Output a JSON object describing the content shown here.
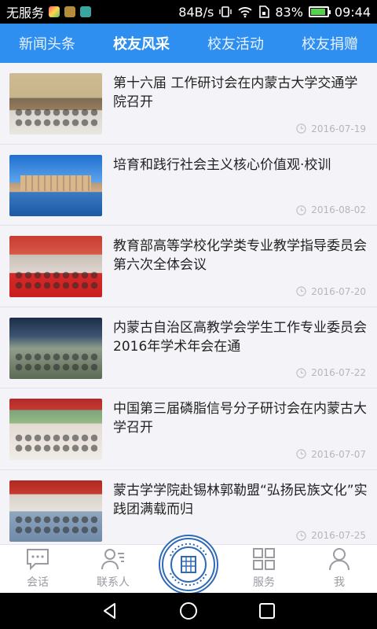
{
  "statusbar": {
    "carrier": "无服务",
    "speed": "84B/s",
    "battery_percent": "83%",
    "battery_level": 0.83,
    "time": "09:44"
  },
  "tabs": [
    {
      "label": "新闻头条",
      "active": false
    },
    {
      "label": "校友风采",
      "active": true
    },
    {
      "label": "校友活动",
      "active": false
    },
    {
      "label": "校友捐赠",
      "active": false
    }
  ],
  "news": [
    {
      "title": "第十六届 工作研讨会在内蒙古大学交通学院召开",
      "date": "2016-07-19"
    },
    {
      "title": "培育和践行社会主义核心价值观·校训",
      "date": "2016-08-02"
    },
    {
      "title": "教育部高等学校化学类专业教学指导委员会第六次全体会议",
      "date": "2016-07-20"
    },
    {
      "title": "内蒙古自治区高教学会学生工作专业委员会2016年学术年会在通",
      "date": "2016-07-22"
    },
    {
      "title": "中国第三届磷脂信号分子研讨会在内蒙古大学召开",
      "date": "2016-07-07"
    },
    {
      "title": "蒙古学学院赴锡林郭勒盟“弘扬民族文化”实践团满载而归",
      "date": "2016-07-25"
    }
  ],
  "bottomnav": {
    "chat": "会话",
    "contacts": "联系人",
    "services": "服务",
    "me": "我"
  },
  "colors": {
    "tab_bar": "#2f8ff0",
    "accent_logo": "#2f6ab6"
  }
}
